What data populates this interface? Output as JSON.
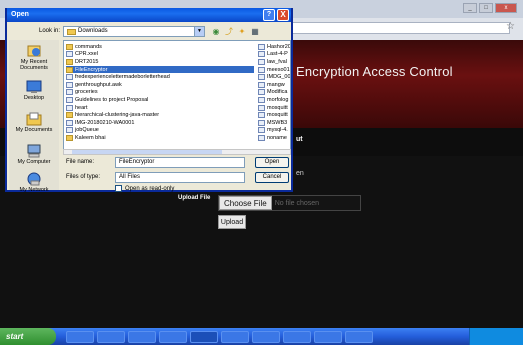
{
  "browser": {
    "window_buttons": [
      "_",
      "□",
      "x"
    ]
  },
  "webpage": {
    "title": "Encryption  Access  Control",
    "nav_label": "ut",
    "side_text": "en",
    "upload_label": "Upload File",
    "choose_file": "Choose File",
    "no_file": "No file chosen",
    "upload_button": "Upload"
  },
  "dialog": {
    "title": "Open",
    "help": "?",
    "close": "X",
    "look_in_label": "Look in:",
    "look_in_value": "Downloads",
    "places": [
      {
        "label": "My Recent\nDocuments"
      },
      {
        "label": "Desktop"
      },
      {
        "label": "My Documents"
      },
      {
        "label": "My Computer"
      },
      {
        "label": "My Network"
      }
    ],
    "files_col1": [
      {
        "name": "commands",
        "kind": "folder"
      },
      {
        "name": "CPR.xxel",
        "kind": "file"
      },
      {
        "name": "DRT2015",
        "kind": "folder"
      },
      {
        "name": "FileEncryptor",
        "kind": "folder",
        "selected": true
      },
      {
        "name": "fredexperiencelettermadeborletterhead",
        "kind": "file"
      },
      {
        "name": "genthroughput.awk",
        "kind": "file"
      },
      {
        "name": "groceries",
        "kind": "file"
      },
      {
        "name": "Guidelines to project Proposal",
        "kind": "file"
      },
      {
        "name": "heart",
        "kind": "file"
      },
      {
        "name": "hierarchical-clustering-java-master",
        "kind": "folder"
      },
      {
        "name": "IMG-20180210-WA0001",
        "kind": "file"
      },
      {
        "name": "jobQueue",
        "kind": "file"
      },
      {
        "name": "Kaleem bhai",
        "kind": "folder"
      }
    ],
    "files_col2": [
      {
        "name": "Hashor20",
        "kind": "file"
      },
      {
        "name": "Last-4-P",
        "kind": "file"
      },
      {
        "name": "law_fval",
        "kind": "file"
      },
      {
        "name": "meeso01",
        "kind": "file"
      },
      {
        "name": "IMDG_00",
        "kind": "file"
      },
      {
        "name": "mangw",
        "kind": "file"
      },
      {
        "name": "Modifica",
        "kind": "file"
      },
      {
        "name": "morfolog",
        "kind": "file"
      },
      {
        "name": "mosquitt",
        "kind": "file"
      },
      {
        "name": "mosquitt",
        "kind": "file"
      },
      {
        "name": "MSWB3",
        "kind": "file"
      },
      {
        "name": "mysql-4.",
        "kind": "file"
      },
      {
        "name": "noname",
        "kind": "file"
      }
    ],
    "file_name_label": "File name:",
    "file_name_value": "FileEncryptor",
    "file_type_label": "Files of type:",
    "file_type_value": "All Files",
    "read_only_label": "Open as read-only",
    "open_button": "Open",
    "cancel_button": "Cancel"
  },
  "taskbar": {
    "start_label": "start"
  }
}
